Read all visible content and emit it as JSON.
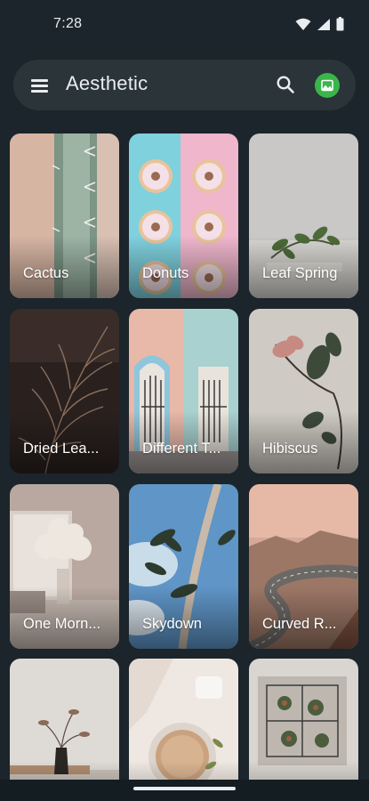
{
  "status_bar": {
    "time": "7:28"
  },
  "app_bar": {
    "title": "Aesthetic"
  },
  "wallpapers": [
    {
      "label": "Cactus"
    },
    {
      "label": "Donuts"
    },
    {
      "label": "Leaf Spring"
    },
    {
      "label": "Dried Lea..."
    },
    {
      "label": "Different T..."
    },
    {
      "label": "Hibiscus"
    },
    {
      "label": "One Morn..."
    },
    {
      "label": "Skydown"
    },
    {
      "label": "Curved R..."
    },
    {
      "label": ""
    },
    {
      "label": ""
    },
    {
      "label": ""
    }
  ],
  "colors": {
    "background": "#1b252b",
    "app_bar": "#2a3439",
    "avatar": "#3ab54a"
  },
  "icons": [
    "wifi-icon",
    "cellular-icon",
    "battery-icon",
    "menu-icon",
    "search-icon",
    "image-icon"
  ]
}
